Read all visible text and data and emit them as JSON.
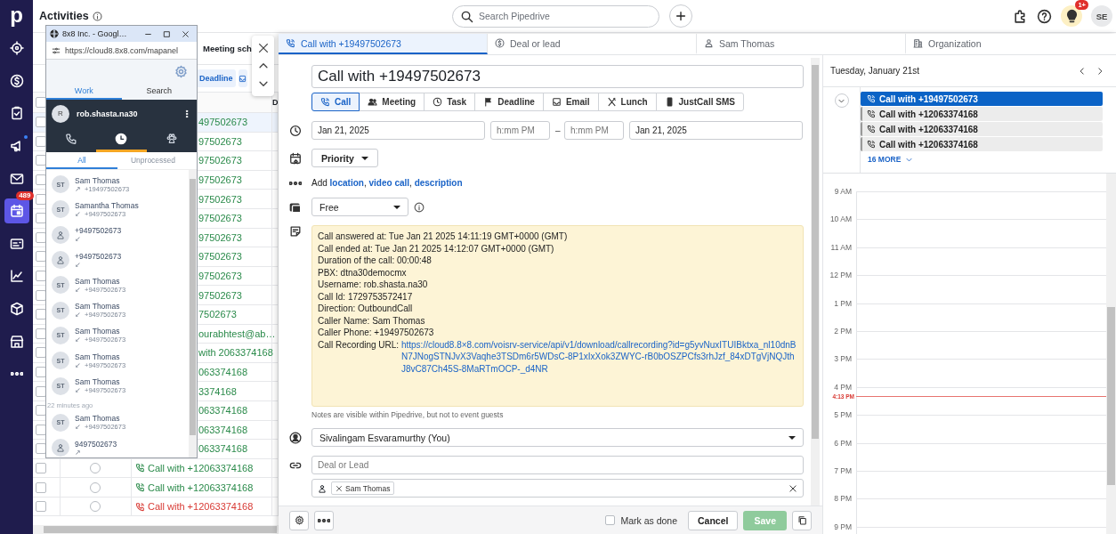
{
  "nav": {
    "logo": "p",
    "items": [
      {
        "selected": false,
        "unread": false
      },
      {
        "selected": false,
        "unread": false
      },
      {
        "selected": false,
        "unread": false
      },
      {
        "selected": false,
        "unread": true
      },
      {
        "selected": false,
        "unread": false
      },
      {
        "selected": true,
        "unread": false,
        "badge": "489"
      },
      {
        "selected": false,
        "unread": false
      },
      {
        "selected": false,
        "unread": false
      },
      {
        "selected": false,
        "unread": false
      },
      {
        "selected": false,
        "unread": false
      },
      {
        "selected": false,
        "unread": false
      }
    ]
  },
  "topbar": {
    "title": "Activities",
    "search": {
      "placeholder": "Search Pipedrive"
    },
    "notification_badge": "1+",
    "avatar": "SE"
  },
  "list": {
    "tab": "Meeting sch",
    "filter_button": "Deadline",
    "select_all_checked": false,
    "column_4": "D",
    "rows": [
      {
        "kind": "clipped",
        "subject": "497502673",
        "color": "#2a8a4a",
        "selected": true,
        "checked": false
      },
      {
        "kind": "clipped",
        "subject": "97502673",
        "color": "#2a8a4a",
        "selected": false,
        "checked": false
      },
      {
        "kind": "clipped",
        "subject": "97502673",
        "color": "#2a8a4a",
        "selected": false,
        "checked": false
      },
      {
        "kind": "clipped",
        "subject": "97502673",
        "color": "#2a8a4a",
        "selected": false,
        "checked": false
      },
      {
        "kind": "clipped",
        "subject": "97502673",
        "color": "#2a8a4a",
        "selected": false,
        "checked": false
      },
      {
        "kind": "clipped",
        "subject": "97502673",
        "color": "#2a8a4a",
        "selected": false,
        "checked": false
      },
      {
        "kind": "clipped",
        "subject": "97502673",
        "color": "#2a8a4a",
        "selected": false,
        "checked": false
      },
      {
        "kind": "clipped",
        "subject": "97502673",
        "color": "#2a8a4a",
        "selected": false,
        "checked": false
      },
      {
        "kind": "clipped",
        "subject": "97502673",
        "color": "#2a8a4a",
        "selected": false,
        "checked": false
      },
      {
        "kind": "clipped",
        "subject": "97502673",
        "color": "#2a8a4a",
        "selected": false,
        "checked": false
      },
      {
        "kind": "clipped",
        "subject": "7502673",
        "color": "#2a8a4a",
        "selected": false,
        "checked": false
      },
      {
        "kind": "clipped",
        "subject": "ourabhtest@ab…",
        "color": "#2a8a4a",
        "selected": false,
        "checked": false
      },
      {
        "kind": "clipped",
        "subject": "with 2063374168",
        "color": "#2a8a4a",
        "selected": false,
        "checked": false
      },
      {
        "kind": "clipped",
        "subject": "063374168",
        "color": "#2a8a4a",
        "selected": false,
        "checked": false
      },
      {
        "kind": "clipped",
        "subject": "3374168",
        "color": "#2a8a4a",
        "selected": false,
        "checked": false
      },
      {
        "kind": "clipped",
        "subject": "063374168",
        "color": "#2a8a4a",
        "selected": false,
        "checked": false
      },
      {
        "kind": "clipped",
        "subject": "063374168",
        "color": "#2a8a4a",
        "selected": false,
        "checked": false
      },
      {
        "kind": "clipped",
        "subject": "063374168",
        "color": "#2a8a4a",
        "selected": false,
        "checked": false
      },
      {
        "kind": "call",
        "subject": "Call with +12063374168",
        "color": "#2a8a4a",
        "selected": false,
        "checked": false
      },
      {
        "kind": "call",
        "subject": "Call with +12063374168",
        "color": "#2a8a4a",
        "selected": false,
        "checked": false
      },
      {
        "kind": "call",
        "subject": "Call with +12063374168",
        "color": "#d83a34",
        "selected": false,
        "checked": false
      }
    ]
  },
  "popup": {
    "title": "8x8 Inc. - Googl…",
    "url": "https://cloud8.8x8.com/mapanel",
    "tabs": [
      {
        "label": "Work",
        "selected": true
      },
      {
        "label": "Search",
        "selected": false
      }
    ],
    "user": {
      "initial": "R",
      "name": "rob.shasta.na30"
    },
    "icon_tabs": [
      {
        "selected": false
      },
      {
        "selected": true
      },
      {
        "selected": false
      }
    ],
    "filters": [
      {
        "label": "All",
        "selected": true
      },
      {
        "label": "Unprocessed",
        "selected": false
      }
    ],
    "calls": [
      {
        "kind": "contact",
        "initials": "ST",
        "name": "Sam Thomas",
        "arrow": "↗",
        "number": "+19497502673"
      },
      {
        "kind": "contact",
        "initials": "ST",
        "name": "Samantha Thomas",
        "arrow": "↙",
        "number": "+9497502673"
      },
      {
        "kind": "unknown",
        "name": "+9497502673",
        "arrow": "↙"
      },
      {
        "kind": "unknown",
        "name": "+9497502673",
        "arrow": "↙"
      },
      {
        "kind": "contact",
        "initials": "ST",
        "name": "Sam Thomas",
        "arrow": "↙",
        "number": "+9497502673"
      },
      {
        "kind": "contact",
        "initials": "ST",
        "name": "Sam Thomas",
        "arrow": "↙",
        "number": "+9497502673"
      },
      {
        "kind": "contact",
        "initials": "ST",
        "name": "Sam Thomas",
        "arrow": "↙",
        "number": "+9497502673"
      },
      {
        "kind": "contact",
        "initials": "ST",
        "name": "Sam Thomas",
        "arrow": "↙",
        "number": "+9497502673"
      },
      {
        "kind": "contact",
        "initials": "ST",
        "name": "Sam Thomas",
        "arrow": "↙",
        "number": "+9497502673"
      },
      {
        "kind": "time",
        "label": "22 minutes ago"
      },
      {
        "kind": "contact",
        "initials": "ST",
        "name": "Sam Thomas",
        "arrow": "↙",
        "number": "+9497502673"
      },
      {
        "kind": "unknown",
        "name": "9497502673",
        "arrow": "↗"
      }
    ]
  },
  "dialog": {
    "tabs": [
      {
        "label": "Call with +19497502673",
        "selected": true
      },
      {
        "label": "Deal or lead",
        "selected": false
      },
      {
        "label": "Sam Thomas",
        "selected": false
      },
      {
        "label": "Organization",
        "selected": false
      }
    ],
    "subject": "Call with +19497502673",
    "types": [
      {
        "label": "Call",
        "selected": true
      },
      {
        "label": "Meeting",
        "selected": false
      },
      {
        "label": "Task",
        "selected": false
      },
      {
        "label": "Deadline",
        "selected": false
      },
      {
        "label": "Email",
        "selected": false
      },
      {
        "label": "Lunch",
        "selected": false
      },
      {
        "label": "JustCall SMS",
        "selected": false
      }
    ],
    "start_date": "Jan 21, 2025",
    "start_time": {
      "placeholder": "h:mm PM"
    },
    "dash": "–",
    "end_time": {
      "placeholder": "h:mm PM"
    },
    "end_date": "Jan 21, 2025",
    "priority": "Priority",
    "add_more": {
      "prefix": "Add ",
      "separator": ", ",
      "links": [
        "location",
        "video call",
        "description"
      ]
    },
    "busy": "Free",
    "note": [
      {
        "text": "Call answered at: Tue Jan 21 2025 14:11:19 GMT+0000 (GMT)"
      },
      {
        "text": "Call ended at: Tue Jan 21 2025 14:12:07 GMT+0000 (GMT)"
      },
      {
        "text": "Duration of the call: 00:00:48"
      },
      {
        "text": "PBX: dtna30democmx"
      },
      {
        "text": "Username: rob.shasta.na30"
      },
      {
        "text": "Call Id: 1729753572417"
      },
      {
        "text": "Direction: OutboundCall"
      },
      {
        "text": "Caller Name: Sam Thomas"
      },
      {
        "text": "Caller Phone: +19497502673"
      },
      {
        "text": "Call Recording URL: ",
        "link": "https://cloud8.8×8.com/voisrv-service/api/v1/download/callrecording?id=g5yvNuxITUIBktxa_nl10dnBN7JNogSTNJvX3Vaqhe3TSDm6r5WDsC-8P1xIxXok3ZWYC-rB0bOSZPCfs3rhJzf_84xDTgVjNQJthJ8vC87Ch45S-8MaRTmOCP-_d4NR"
      }
    ],
    "note_hint": "Notes are visible within Pipedrive, but not to event guests",
    "owner": "Sivalingam Esvaramurthy (You)",
    "deal": {
      "placeholder": "Deal or Lead"
    },
    "participants": [
      "Sam Thomas"
    ],
    "mark_done": {
      "label": "Mark as done",
      "checked": false
    },
    "cancel": "Cancel",
    "save": {
      "label": "Save",
      "disabled": true
    }
  },
  "calendar": {
    "date": "Tuesday, January 21st",
    "all_day": [
      {
        "title": "Call with +19497502673",
        "selected": true
      },
      {
        "title": "Call with +12063374168",
        "selected": false
      },
      {
        "title": "Call with +12063374168",
        "selected": false
      },
      {
        "title": "Call with +12063374168",
        "selected": false
      }
    ],
    "more": "16 MORE",
    "hours": [
      "9 AM",
      "10 AM",
      "11 AM",
      "12 PM",
      "1 PM",
      "2 PM",
      "3 PM",
      "4 PM",
      "5 PM",
      "6 PM",
      "7 PM",
      "8 PM",
      "9 PM"
    ],
    "now": "4:13 PM"
  }
}
